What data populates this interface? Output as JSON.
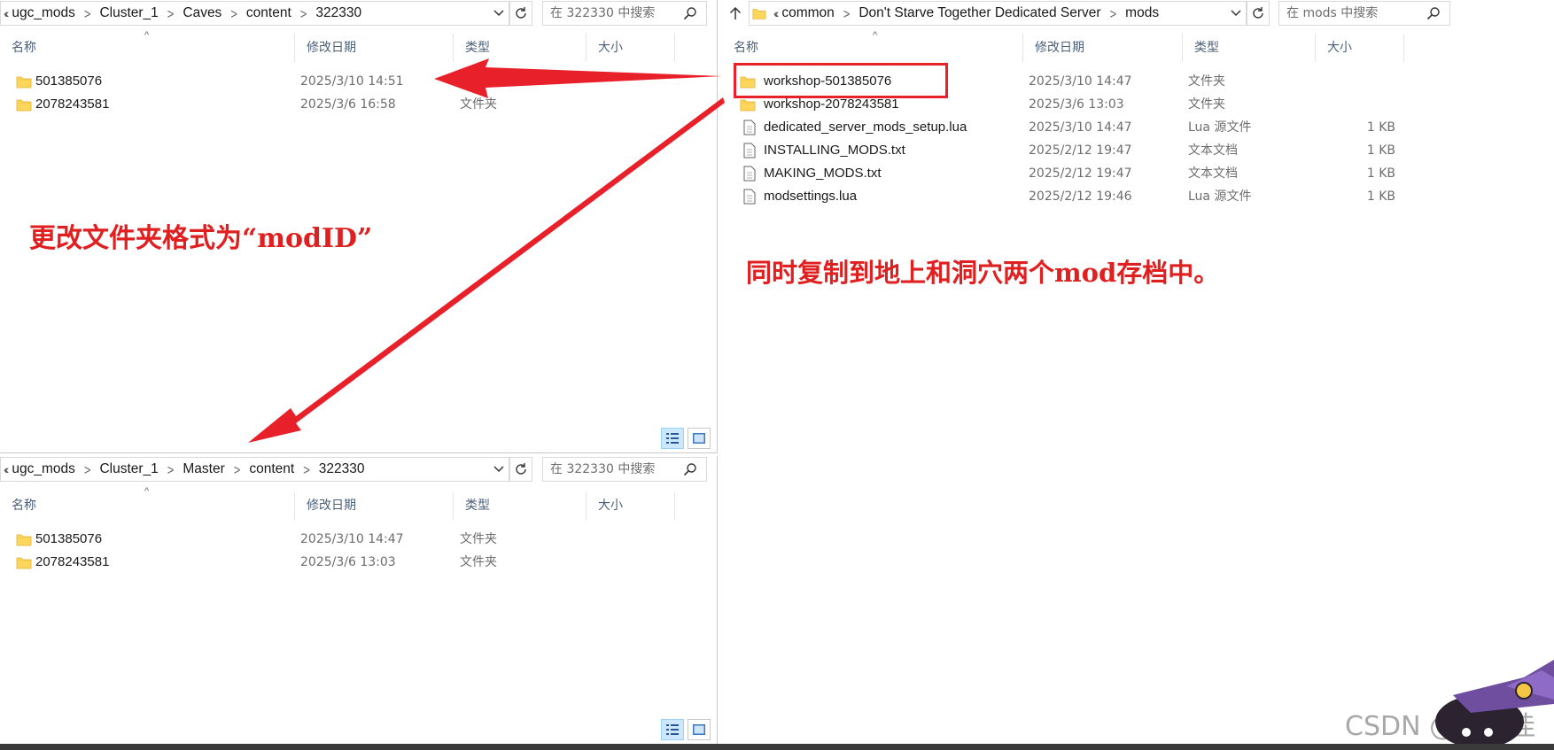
{
  "caves_window": {
    "breadcrumb": [
      "ugc_mods",
      "Cluster_1",
      "Caves",
      "content",
      "322330"
    ],
    "search_placeholder": "在 322330 中搜索",
    "columns": {
      "name": "名称",
      "date": "修改日期",
      "type": "类型",
      "size": "大小"
    },
    "rows": [
      {
        "name": "501385076",
        "date": "2025/3/10 14:51",
        "type": "文件夹"
      },
      {
        "name": "2078243581",
        "date": "2025/3/6 16:58",
        "type": "文件夹"
      }
    ]
  },
  "master_window": {
    "breadcrumb": [
      "ugc_mods",
      "Cluster_1",
      "Master",
      "content",
      "322330"
    ],
    "search_placeholder": "在 322330 中搜索",
    "columns": {
      "name": "名称",
      "date": "修改日期",
      "type": "类型",
      "size": "大小"
    },
    "rows": [
      {
        "name": "501385076",
        "date": "2025/3/10 14:47",
        "type": "文件夹"
      },
      {
        "name": "2078243581",
        "date": "2025/3/6 13:03",
        "type": "文件夹"
      }
    ]
  },
  "mods_window": {
    "breadcrumb": [
      "common",
      "Don't Starve Together Dedicated Server",
      "mods"
    ],
    "search_placeholder": "在 mods 中搜索",
    "columns": {
      "name": "名称",
      "date": "修改日期",
      "type": "类型",
      "size": "大小"
    },
    "rows": [
      {
        "name": "workshop-501385076",
        "date": "2025/3/10 14:47",
        "type": "文件夹",
        "size": "",
        "icon": "folder-icon"
      },
      {
        "name": "workshop-2078243581",
        "date": "2025/3/6 13:03",
        "type": "文件夹",
        "size": "",
        "icon": "folder-icon"
      },
      {
        "name": "dedicated_server_mods_setup.lua",
        "date": "2025/3/10 14:47",
        "type": "Lua 源文件",
        "size": "1 KB",
        "icon": "file-icon"
      },
      {
        "name": "INSTALLING_MODS.txt",
        "date": "2025/2/12 19:47",
        "type": "文本文档",
        "size": "1 KB",
        "icon": "file-icon"
      },
      {
        "name": "MAKING_MODS.txt",
        "date": "2025/2/12 19:47",
        "type": "文本文档",
        "size": "1 KB",
        "icon": "file-icon"
      },
      {
        "name": "modsettings.lua",
        "date": "2025/2/12 19:46",
        "type": "Lua 源文件",
        "size": "1 KB",
        "icon": "file-icon"
      }
    ]
  },
  "annotations": {
    "left": "更改文件夹格式为“modID”",
    "right": "同时复制到地上和洞穴两个mod存档中。"
  },
  "watermark": "CSDN @夜行佳",
  "colors": {
    "annotation_red": "#e8202a",
    "header_text": "#4c607a",
    "folder_yellow": "#ffd65c"
  }
}
